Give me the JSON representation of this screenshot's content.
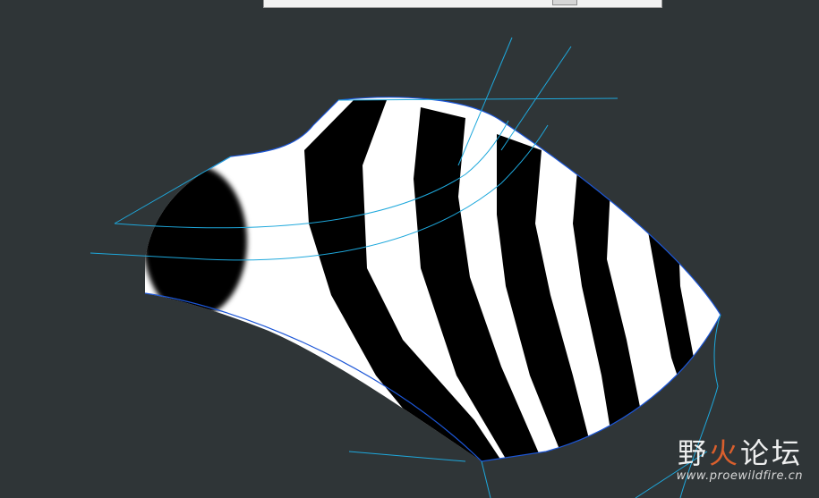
{
  "viewport": {
    "background": "#2f3537",
    "surface": {
      "name": "zebra-striped-surface",
      "fill_light": "#ffffff",
      "fill_dark": "#000000",
      "edge_color": "#1c56d6"
    },
    "construction_line_color": "#1ea8dc"
  },
  "watermark": {
    "title_part1": "野",
    "title_part2": "火",
    "title_part3": "论坛",
    "url": "www.proewildfire.cn",
    "accent_color": "#e8632d"
  }
}
